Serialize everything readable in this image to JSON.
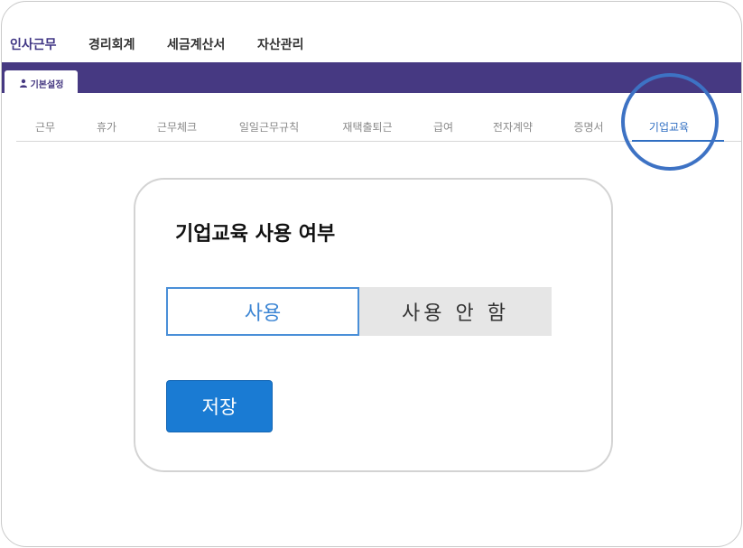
{
  "top_menu": {
    "items": [
      {
        "label": "인사근무"
      },
      {
        "label": "경리회계"
      },
      {
        "label": "세금계산서"
      },
      {
        "label": "자산관리"
      }
    ]
  },
  "sub_tab": {
    "label": "기본설정",
    "icon": "person-icon"
  },
  "nav_tabs": [
    {
      "label": "근무"
    },
    {
      "label": "휴가"
    },
    {
      "label": "근무체크"
    },
    {
      "label": "일일근무규칙"
    },
    {
      "label": "재택출퇴근"
    },
    {
      "label": "급여"
    },
    {
      "label": "전자계약"
    },
    {
      "label": "증명서"
    },
    {
      "label": "기업교육"
    }
  ],
  "active_tab": "기업교육",
  "card": {
    "title": "기업교육 사용 여부",
    "option_on": "사용",
    "option_off": "사용 안 함",
    "selected": "사용",
    "save_label": "저장"
  },
  "colors": {
    "primary_purple": "#463982",
    "accent_blue": "#2f6ec2",
    "button_blue": "#1a7bd3",
    "highlight_circle": "#3d72c4"
  }
}
